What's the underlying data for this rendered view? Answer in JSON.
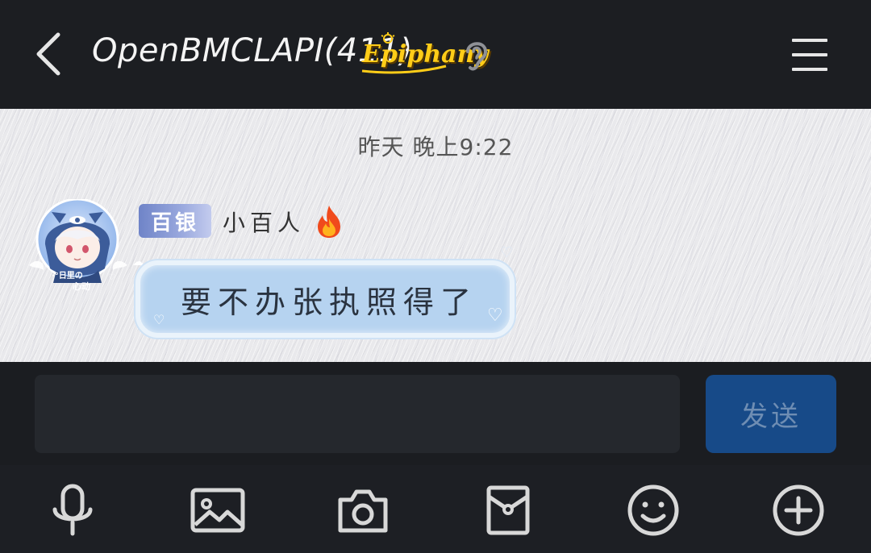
{
  "header": {
    "title": "OpenBMCLAPI(411)",
    "brand": "Epiphany",
    "icons": {
      "back": "back-arrow-icon",
      "ear": "ear-icon",
      "menu": "hamburger-menu-icon"
    }
  },
  "chat": {
    "timestamp": "昨天 晚上9:22",
    "messages": [
      {
        "badge": "百银",
        "sender": "小百人",
        "sender_icon": "fire-icon",
        "text": "要不办张执照得了"
      }
    ]
  },
  "input": {
    "value": "",
    "placeholder": "",
    "send_label": "发送"
  },
  "toolbar": {
    "items": [
      "microphone-icon",
      "image-icon",
      "camera-icon",
      "red-packet-icon",
      "emoji-icon",
      "plus-icon"
    ]
  },
  "colors": {
    "header_bg": "#1c1e22",
    "send_button": "#174a88",
    "bubble": "#b6d3f0",
    "brand": "#ffcd18"
  }
}
